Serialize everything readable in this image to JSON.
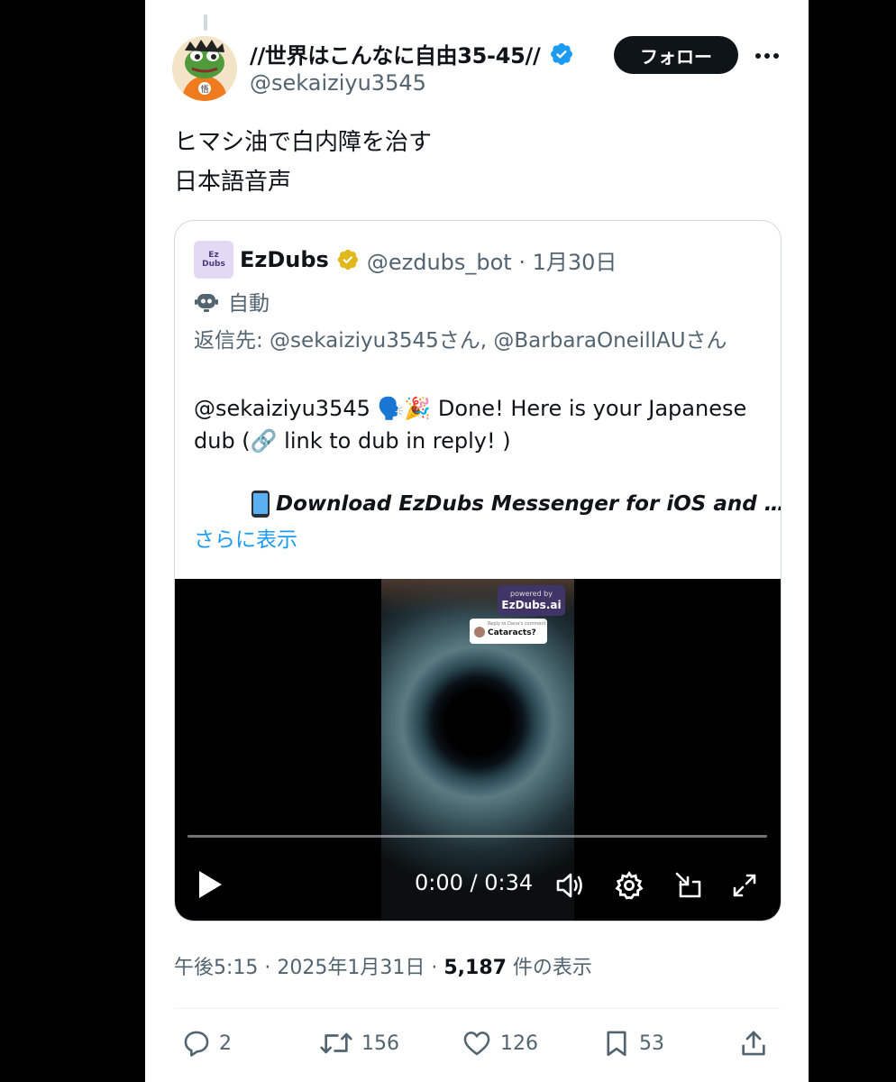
{
  "author": {
    "display_name": "//世界はこんなに自由35-45//",
    "handle": "@sekaiziyu3545",
    "follow_label": "フォロー"
  },
  "tweet": {
    "lines": [
      "ヒマシ油で白内障を治す",
      "日本語音声"
    ]
  },
  "quote": {
    "logo_text_1": "Ez",
    "logo_text_2": "Dubs",
    "name": "EzDubs",
    "handle_date": "@ezdubs_bot · 1月30日",
    "automated_label": "自動",
    "reply_to": "返信先: @sekaiziyu3545さん, @BarbaraOneillAUさん",
    "body_mention": "@sekaiziyu3545",
    "body_emoji": "🗣️🎉",
    "body_text": " Done! Here is your Japanese dub (🔗 link to dub in reply! )",
    "download_text": "Download  EzDubs Messenger for iOS and …",
    "show_more": "さらに表示"
  },
  "video": {
    "overlay_powered": "powered by",
    "overlay_brand": "EzDubs.ai",
    "overlay_reply": "Reply to Dana's comment",
    "overlay_comment": "Cataracts?",
    "time": "0:00 / 0:34",
    "progress": 0
  },
  "meta": {
    "time_date": "午後5:15 · 2025年1月31日 · ",
    "views": "5,187",
    "views_label": " 件の表示"
  },
  "actions": {
    "replies": "2",
    "retweets": "156",
    "likes": "126",
    "bookmarks": "53"
  },
  "colors": {
    "verified_blue": "#1d9bf0",
    "verified_gold": "#e2b719",
    "link": "#1d9bf0",
    "secondary_text": "#536471"
  }
}
